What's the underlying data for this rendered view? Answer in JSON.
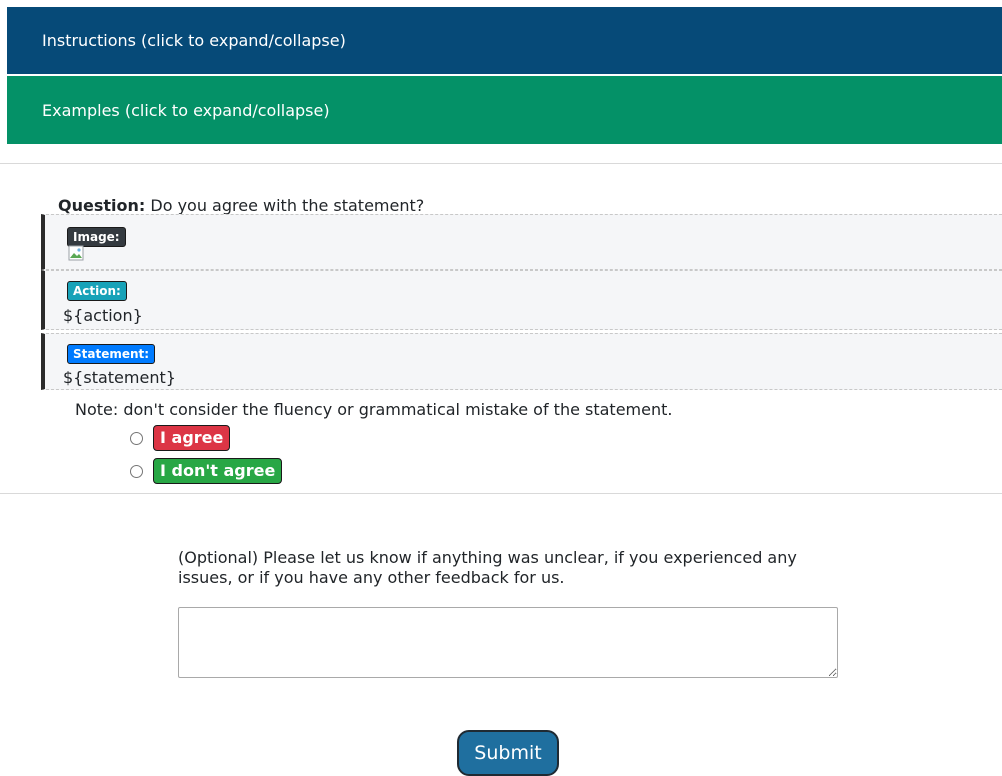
{
  "panels": {
    "instructions_label": "Instructions (click to expand/collapse)",
    "examples_label": "Examples (click to expand/collapse)"
  },
  "question": {
    "prefix": "Question:",
    "text": "Do you agree with the statement?"
  },
  "fields": {
    "image_label": "Image:",
    "action_label": "Action:",
    "action_value": "${action}",
    "statement_label": "Statement:",
    "statement_value": "${statement}"
  },
  "note": "Note: don't consider the fluency or grammatical mistake of the statement.",
  "options": {
    "agree": "I agree",
    "disagree": "I don't agree"
  },
  "feedback": {
    "prompt": "(Optional) Please let us know if anything was unclear, if you experienced any issues, or if you have any other feedback for us.",
    "value": ""
  },
  "submit_label": "Submit",
  "colors": {
    "instructions_bg": "#064a78",
    "examples_bg": "#049167",
    "agree_bg": "#dc3545",
    "disagree_bg": "#28a745",
    "submit_bg": "#1f6f9f"
  },
  "icons": {
    "broken_image": "broken-image-icon"
  }
}
